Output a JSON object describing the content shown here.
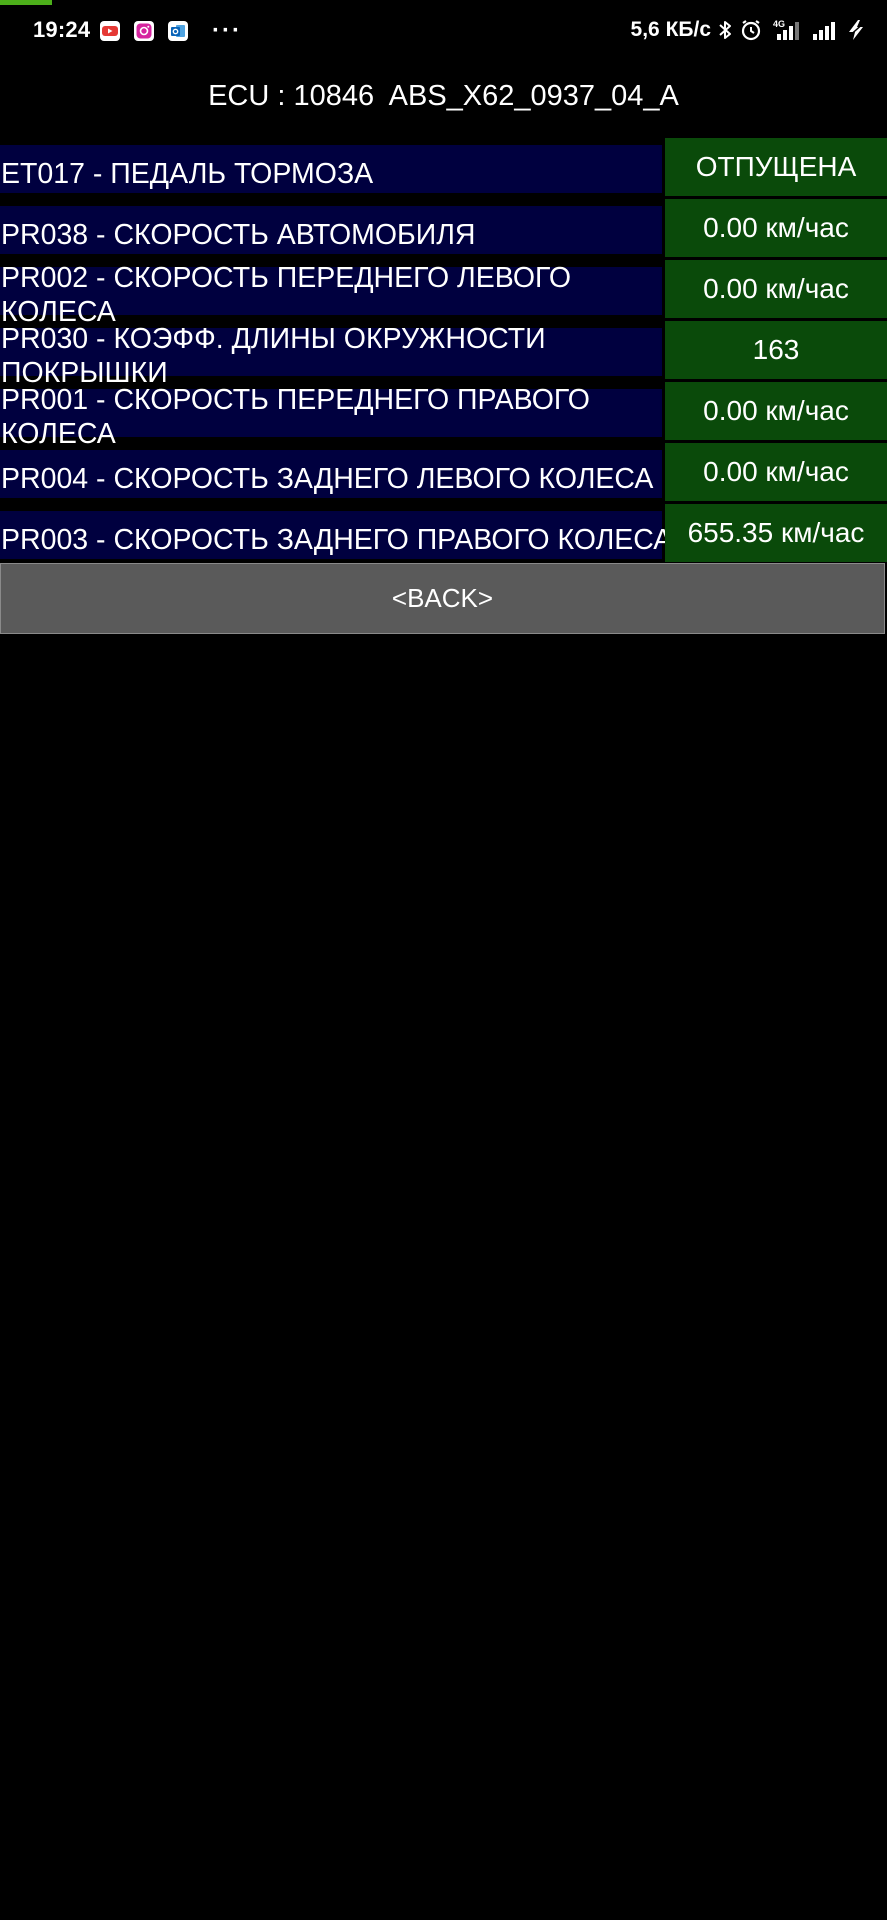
{
  "status_bar": {
    "time": "19:24",
    "notification_icons": [
      "youtube-icon",
      "instagram-icon",
      "outlook-icon"
    ],
    "more": "···",
    "network_speed": "5,6 КБ/с",
    "network_type": "4G",
    "right_icons": [
      "bluetooth-icon",
      "alarm-icon",
      "signal-4g-icon",
      "signal-icon",
      "charging-icon"
    ]
  },
  "header": {
    "ecu_title": "ECU : 10846  ABS_X62_0937_04_A"
  },
  "params": [
    {
      "name": "ET017 - ПЕДАЛЬ ТОРМОЗА",
      "value": "ОТПУЩЕНА"
    },
    {
      "name": "PR038 - СКОРОСТЬ АВТОМОБИЛЯ",
      "value": "0.00 км/час"
    },
    {
      "name": "PR002 - СКОРОСТЬ ПЕРЕДНЕГО ЛЕВОГО\nКОЛЕСА",
      "value": "0.00 км/час"
    },
    {
      "name": "PR030 - КОЭФФ. ДЛИНЫ ОКРУЖНОСТИ\nПОКРЫШКИ",
      "value": "163"
    },
    {
      "name": "PR001 - СКОРОСТЬ ПЕРЕДНЕГО ПРАВОГО\nКОЛЕСА",
      "value": "0.00 км/час"
    },
    {
      "name": "PR004 - СКОРОСТЬ ЗАДНЕГО ЛЕВОГО КОЛЕСА",
      "value": "0.00 км/час"
    },
    {
      "name": "PR003 - СКОРОСТЬ ЗАДНЕГО ПРАВОГО КОЛЕСА",
      "value": "655.35 км/час"
    }
  ],
  "back_button": {
    "label": "<BACK>"
  },
  "colors": {
    "background": "#000000",
    "name_cell": "#00003f",
    "value_cell": "#0a4a0a",
    "button": "#5a5a5a",
    "accent": "#4caf1a"
  }
}
